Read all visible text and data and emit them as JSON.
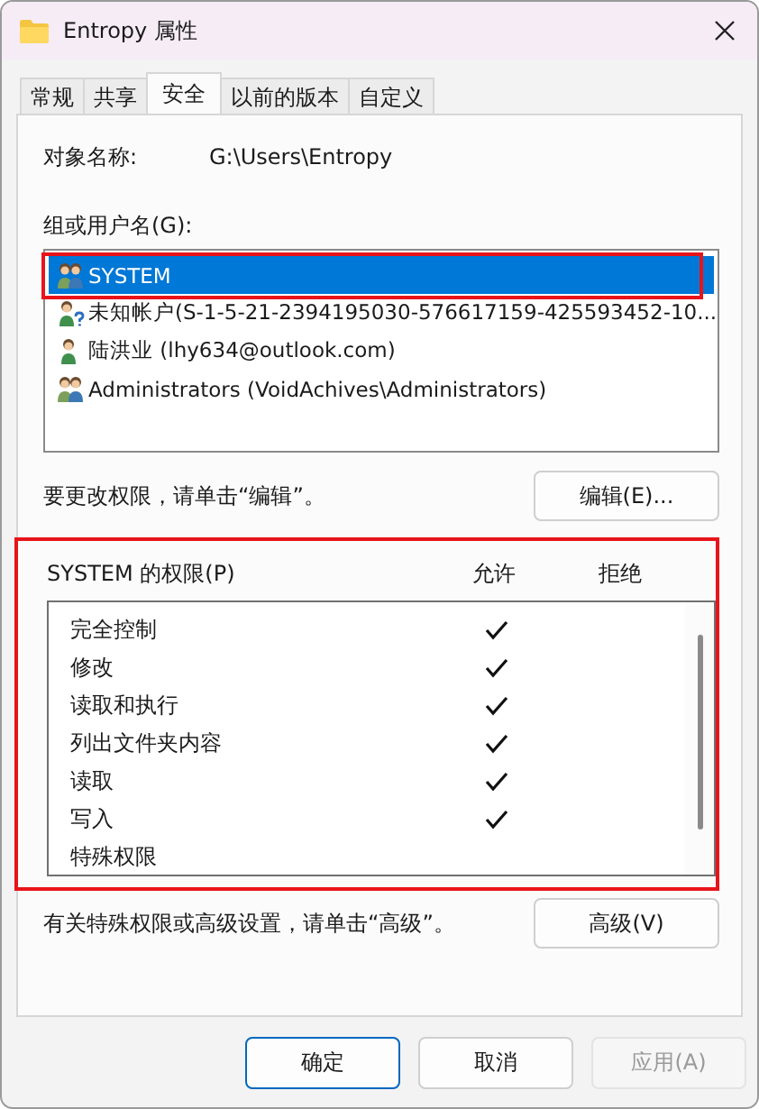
{
  "window": {
    "title": "Entropy 属性"
  },
  "tabs": [
    {
      "label": "常规",
      "selected": false
    },
    {
      "label": "共享",
      "selected": false
    },
    {
      "label": "安全",
      "selected": true
    },
    {
      "label": "以前的版本",
      "selected": false
    },
    {
      "label": "自定义",
      "selected": false
    }
  ],
  "object_name": {
    "label": "对象名称:",
    "value": "G:\\Users\\Entropy"
  },
  "users": {
    "label": "组或用户名(G):",
    "items": [
      {
        "kind": "group",
        "name": "SYSTEM",
        "selected": true,
        "highlighted": true
      },
      {
        "kind": "unknown",
        "name": "未知帐户(S-1-5-21-2394195030-576617159-425593452-10...",
        "selected": false,
        "highlighted": false
      },
      {
        "kind": "user",
        "name": "陆洪业 (lhy634@outlook.com)",
        "selected": false,
        "highlighted": false
      },
      {
        "kind": "group",
        "name": "Administrators (VoidAchives\\Administrators)",
        "selected": false,
        "highlighted": false
      }
    ]
  },
  "edit_hint": "要更改权限，请单击“编辑”。",
  "edit_button": "编辑(E)...",
  "permissions": {
    "highlighted": true,
    "title": "SYSTEM 的权限(P)",
    "allow_header": "允许",
    "deny_header": "拒绝",
    "items": [
      {
        "name": "完全控制",
        "allow": true,
        "deny": false
      },
      {
        "name": "修改",
        "allow": true,
        "deny": false
      },
      {
        "name": "读取和执行",
        "allow": true,
        "deny": false
      },
      {
        "name": "列出文件夹内容",
        "allow": true,
        "deny": false
      },
      {
        "name": "读取",
        "allow": true,
        "deny": false
      },
      {
        "name": "写入",
        "allow": true,
        "deny": false
      },
      {
        "name": "特殊权限",
        "allow": false,
        "deny": false
      }
    ]
  },
  "advanced_hint": "有关特殊权限或高级设置，请单击“高级”。",
  "advanced_button": "高级(V)",
  "buttons": [
    {
      "label": "确定",
      "kind": "default",
      "disabled": false
    },
    {
      "label": "取消",
      "kind": "normal",
      "disabled": false
    },
    {
      "label": "应用(A)",
      "kind": "normal",
      "disabled": true
    }
  ]
}
